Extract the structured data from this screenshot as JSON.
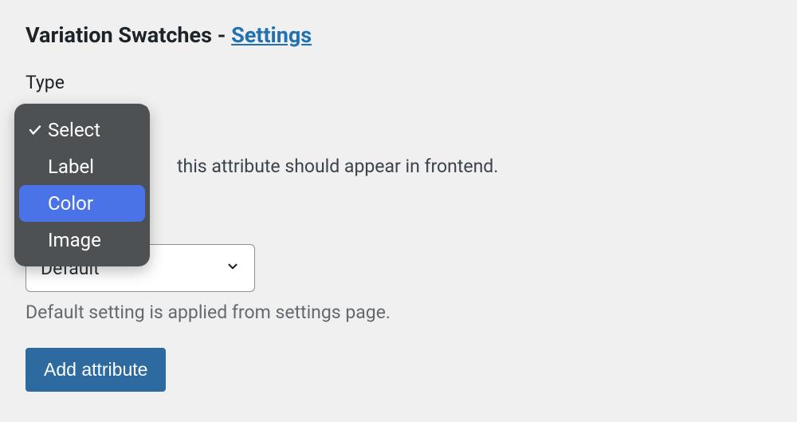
{
  "heading": {
    "text": "Variation Swatches - ",
    "link_text": "Settings"
  },
  "type_field": {
    "label": "Type",
    "help_partial": "this attribute should appear in frontend."
  },
  "dropdown": {
    "options": [
      {
        "label": "Select",
        "checked": true,
        "highlight": false
      },
      {
        "label": "Label",
        "checked": false,
        "highlight": false
      },
      {
        "label": "Color",
        "checked": false,
        "highlight": true
      },
      {
        "label": "Image",
        "checked": false,
        "highlight": false
      }
    ]
  },
  "shape_select": {
    "value": "Default",
    "help": "Default setting is applied from settings page."
  },
  "buttons": {
    "add_attribute": "Add attribute"
  }
}
